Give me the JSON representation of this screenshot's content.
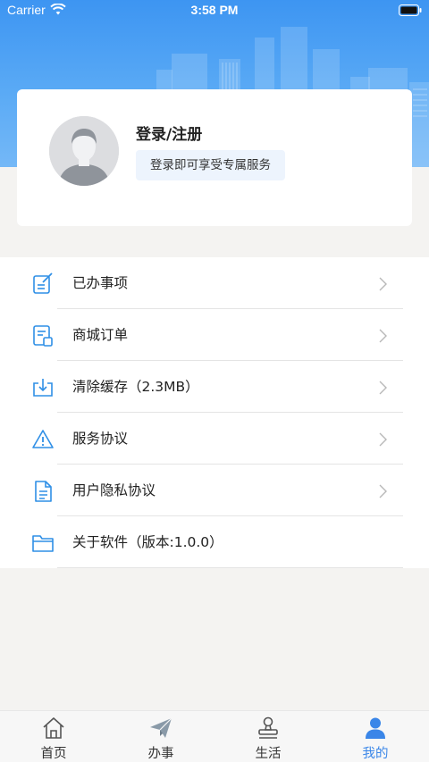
{
  "status_bar": {
    "carrier": "Carrier",
    "time": "3:58 PM"
  },
  "profile": {
    "title": "登录/注册",
    "hint": "登录即可享受专属服务"
  },
  "menu": {
    "items": [
      {
        "label": "已办事项",
        "icon": "edit-document-icon",
        "has_chevron": true
      },
      {
        "label": "商城订单",
        "icon": "order-receipt-icon",
        "has_chevron": true
      },
      {
        "label": "清除缓存（2.3MB）",
        "icon": "download-tray-icon",
        "has_chevron": true
      },
      {
        "label": "服务协议",
        "icon": "warning-triangle-icon",
        "has_chevron": true
      },
      {
        "label": "用户隐私协议",
        "icon": "document-icon",
        "has_chevron": true
      },
      {
        "label": "关于软件（版本:1.0.0）",
        "icon": "folder-icon",
        "has_chevron": false
      }
    ]
  },
  "tab_bar": {
    "tabs": [
      {
        "label": "首页",
        "icon": "home-icon",
        "active": false
      },
      {
        "label": "办事",
        "icon": "paper-plane-icon",
        "active": false
      },
      {
        "label": "生活",
        "icon": "stamp-icon",
        "active": false
      },
      {
        "label": "我的",
        "icon": "user-icon",
        "active": true
      }
    ]
  },
  "colors": {
    "accent": "#3a86e8",
    "header_gradient_top": "#3d95f2",
    "header_gradient_bottom": "#74b8f7",
    "icon_blue": "#2f8fe6",
    "page_background": "#f4f3f1"
  }
}
